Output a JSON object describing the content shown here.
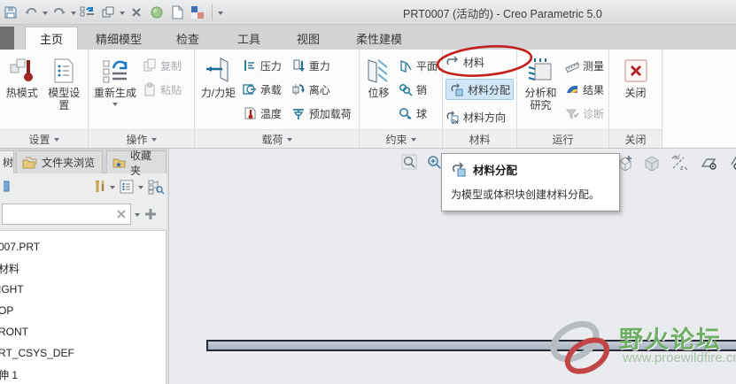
{
  "title_bar": {
    "title": "PRT0007 (活动的) - Creo Parametric 5.0"
  },
  "tabs": {
    "home": "主页",
    "refine_model": "精细模型",
    "inspect": "检查",
    "tools": "工具",
    "view": "视图",
    "flexible_modeling": "柔性建模"
  },
  "ribbon": {
    "settings": {
      "label": "设置",
      "heat_mode": "热模式",
      "model_setup": "模型设置"
    },
    "operations": {
      "label": "操作",
      "regenerate": "重新生成",
      "copy": "复制",
      "paste": "粘贴"
    },
    "loads": {
      "label": "载荷",
      "force_moment": "力/力矩",
      "pressure": "压力",
      "bearing": "承载",
      "temperature": "温度",
      "gravity": "重力",
      "centrifugal": "离心",
      "preload": "预加载荷"
    },
    "constraints": {
      "label": "约束",
      "displacement": "位移",
      "planar": "平面",
      "pin": "销",
      "ball": "球"
    },
    "materials": {
      "label": "材料",
      "material": "材料",
      "material_assignment": "材料分配",
      "material_orientation": "材料方向"
    },
    "run": {
      "label": "运行",
      "analyses": "分析和研究",
      "measure": "测量",
      "results": "结果",
      "diagnostics": "诊断"
    },
    "close": {
      "label": "关闭",
      "close_button": "关闭"
    }
  },
  "left_panel": {
    "tabs": {
      "model_tree_partial": "树",
      "folder_browser": "文件夹浏览",
      "favorites": "收藏夹"
    },
    "search": {
      "value": "",
      "placeholder": ""
    },
    "tree_items": [
      "007.PRT",
      "材料",
      "IGHT",
      "OP",
      "RONT",
      "RT_CSYS_DEF",
      "伸 1"
    ]
  },
  "tooltip": {
    "title": "材料分配",
    "description": "为模型或体积块创建材料分配。"
  },
  "watermark": {
    "line1": "野火论坛",
    "line2": "www.proewildfire.cn"
  },
  "colors": {
    "highlight_bg": "#cfe7f8",
    "annotation_red": "#c4201d",
    "icon_teal": "#2e7da0",
    "watermark_green": "#6fae66"
  }
}
